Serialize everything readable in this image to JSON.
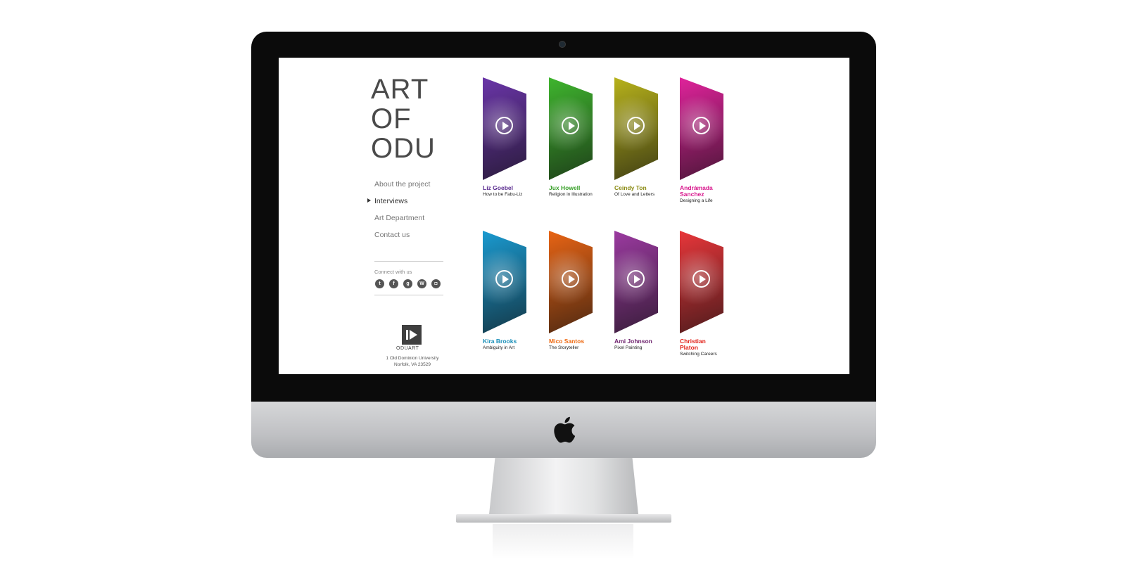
{
  "site": {
    "title_lines": [
      "ART",
      "OF",
      "ODU"
    ],
    "nav": [
      {
        "label": "About the project",
        "active": false
      },
      {
        "label": "Interviews",
        "active": true
      },
      {
        "label": "Art Department",
        "active": false
      },
      {
        "label": "Contact us",
        "active": false
      }
    ],
    "connect_label": "Connect with us",
    "social_icons": [
      "twitter-icon",
      "facebook-icon",
      "google-plus-icon",
      "wordpress-icon",
      "instagram-icon"
    ],
    "logo_text": "ODUART",
    "address_line1": "1 Old Dominion University",
    "address_line2": "Norfolk, VA 23529"
  },
  "interviews": [
    {
      "name": "Liz Goebel",
      "subtitle": "How to be Fabu-Liz",
      "color": "#5b2d90",
      "bg": "#6a35a8"
    },
    {
      "name": "Jux Howell",
      "subtitle": "Religion in Illustration",
      "color": "#3aa12b",
      "bg": "#3fb52e"
    },
    {
      "name": "Ceindy Ton",
      "subtitle": "Of Love and Letters",
      "color": "#8a8a12",
      "bg": "#b7b21b"
    },
    {
      "name": "Andrámada Sanchez",
      "subtitle": "Designing a Life",
      "color": "#d8168c",
      "bg": "#e0239b"
    },
    {
      "name": "Kira Brooks",
      "subtitle": "Ambiguity in Art",
      "color": "#1a8fb8",
      "bg": "#1a9ad0"
    },
    {
      "name": "Mico Santos",
      "subtitle": "The Storyteller",
      "color": "#ee6a12",
      "bg": "#e86414"
    },
    {
      "name": "Ami Johnson",
      "subtitle": "Pixel Painting",
      "color": "#6c1f6c",
      "bg": "#9b3aa0"
    },
    {
      "name": "Christian Platon",
      "subtitle": "Switching Careers",
      "color": "#e2231a",
      "bg": "#e8363a"
    }
  ]
}
